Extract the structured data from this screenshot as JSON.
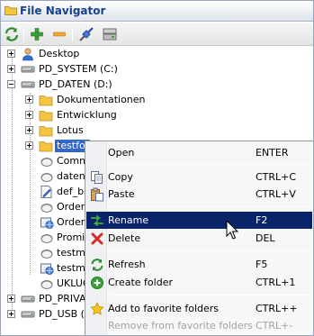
{
  "window": {
    "title": "File Navigator"
  },
  "toolbar": {
    "buttons": [
      {
        "icon": "refresh-icon"
      },
      {
        "icon": "add-icon"
      },
      {
        "icon": "remove-icon"
      },
      {
        "icon": "connect-icon"
      },
      {
        "icon": "drive-properties-icon"
      }
    ]
  },
  "tree": {
    "desktop": "Desktop",
    "pd_system": "PD_SYSTEM (C:)",
    "pd_daten": "PD_DATEN (D:)",
    "dokumentationen": "Dokumentationen",
    "entwicklung": "Entwicklung",
    "lotus": "Lotus",
    "testfolder": "testfol",
    "commi": "Commi",
    "daten": "daten.",
    "def_ba": "def_ba",
    "order1": "Order_",
    "order2": "Order",
    "promin": "Promin",
    "testma1": "testma",
    "testma2": "testma",
    "uklug": "UKLUG",
    "pd_privat": "PD_PRIVAT",
    "pd_usb": "PD_USB (K"
  },
  "context_menu": {
    "items": [
      {
        "label": "Open",
        "shortcut": "ENTER",
        "icon": ""
      },
      {
        "label": "Copy",
        "shortcut": "CTRL+C",
        "icon": "copy-icon"
      },
      {
        "label": "Paste",
        "shortcut": "CTRL+V",
        "icon": "paste-icon"
      },
      {
        "label": "Rename",
        "shortcut": "F2",
        "icon": "rename-icon",
        "highlighted": true
      },
      {
        "label": "Delete",
        "shortcut": "DEL",
        "icon": "delete-icon"
      },
      {
        "label": "Refresh",
        "shortcut": "F5",
        "icon": "refresh-icon"
      },
      {
        "label": "Create folder",
        "shortcut": "CTRL+1",
        "icon": "create-folder-icon"
      },
      {
        "label": "Add to favorite folders",
        "shortcut": "CTRL++",
        "icon": "star-icon"
      },
      {
        "label": "Remove from favorite folders",
        "shortcut": "CTRL+-",
        "icon": "",
        "disabled": true
      }
    ]
  },
  "colors": {
    "title_text": "#15428b",
    "selection": "#3366cc",
    "menu_highlight": "#0a246a",
    "folder": "#f5c542"
  }
}
